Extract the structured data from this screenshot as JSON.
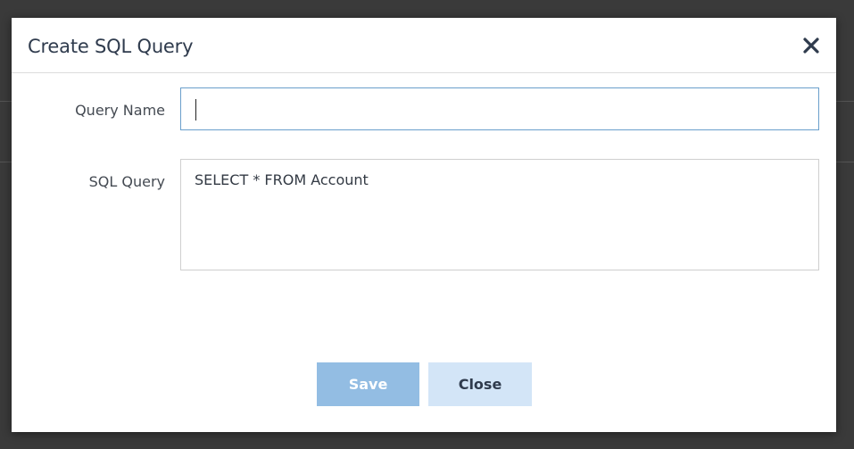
{
  "dialog": {
    "title": "Create SQL Query",
    "close_icon": "close-icon"
  },
  "form": {
    "query_name": {
      "label": "Query Name",
      "value": ""
    },
    "sql_query": {
      "label": "SQL Query",
      "value": "SELECT * FROM Account"
    }
  },
  "buttons": {
    "save_label": "Save",
    "close_label": "Close"
  },
  "colors": {
    "backdrop": "#3a3a3a",
    "title": "#2f3b4d",
    "input_focus_border": "#6a9fcb",
    "save_button_bg": "#93bde3",
    "close_button_bg": "#d3e5f7"
  }
}
